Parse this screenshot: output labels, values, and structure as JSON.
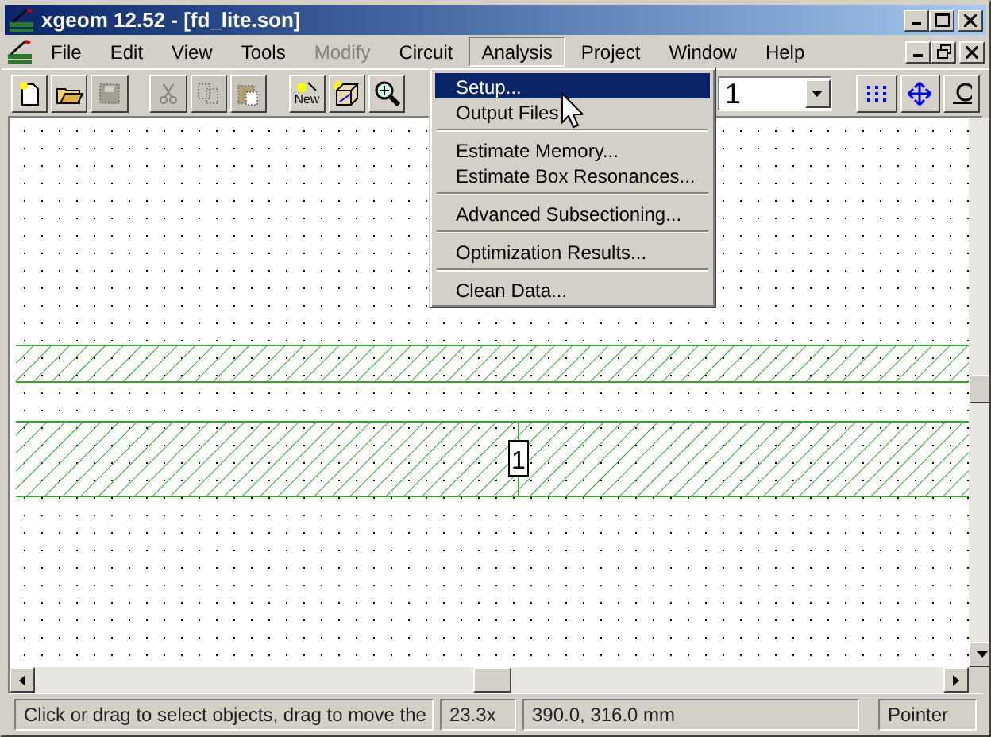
{
  "window": {
    "title": "xgeom 12.52 - [fd_lite.son]"
  },
  "menus": [
    {
      "label": "File",
      "selected": false,
      "disabled": false
    },
    {
      "label": "Edit",
      "selected": false,
      "disabled": false
    },
    {
      "label": "View",
      "selected": false,
      "disabled": false
    },
    {
      "label": "Tools",
      "selected": false,
      "disabled": false
    },
    {
      "label": "Modify",
      "selected": false,
      "disabled": true
    },
    {
      "label": "Circuit",
      "selected": false,
      "disabled": false
    },
    {
      "label": "Analysis",
      "selected": true,
      "disabled": false
    },
    {
      "label": "Project",
      "selected": false,
      "disabled": false
    },
    {
      "label": "Window",
      "selected": false,
      "disabled": false
    },
    {
      "label": "Help",
      "selected": false,
      "disabled": false
    }
  ],
  "dropdown": [
    {
      "kind": "item",
      "label": "Setup...",
      "selected": true
    },
    {
      "kind": "item",
      "label": "Output Files",
      "selected": false
    },
    {
      "kind": "separator"
    },
    {
      "kind": "item",
      "label": "Estimate Memory...",
      "selected": false
    },
    {
      "kind": "item",
      "label": "Estimate Box Resonances...",
      "selected": false
    },
    {
      "kind": "separator"
    },
    {
      "kind": "item",
      "label": "Advanced Subsectioning...",
      "selected": false
    },
    {
      "kind": "separator"
    },
    {
      "kind": "item",
      "label": "Optimization Results...",
      "selected": false
    },
    {
      "kind": "separator"
    },
    {
      "kind": "item",
      "label": "Clean Data...",
      "selected": false
    }
  ],
  "toolbar": [
    {
      "kind": "new",
      "disabled": false
    },
    {
      "kind": "open",
      "disabled": false
    },
    {
      "kind": "save",
      "disabled": true
    },
    {
      "kind": "gap"
    },
    {
      "kind": "cut",
      "disabled": true
    },
    {
      "kind": "copy",
      "disabled": true
    },
    {
      "kind": "paste",
      "disabled": true
    },
    {
      "kind": "gap"
    },
    {
      "kind": "new-geometry",
      "disabled": false,
      "caption": "New"
    },
    {
      "kind": "box",
      "disabled": false
    },
    {
      "kind": "zoom",
      "disabled": false
    }
  ],
  "level_select": {
    "value": "1"
  },
  "canvas": {
    "port_label": "1"
  },
  "status_bar": {
    "message": "Click or drag to select objects, drag to move the",
    "zoom": "23.3x",
    "position": "390.0, 316.0 mm",
    "mode": "Pointer"
  }
}
